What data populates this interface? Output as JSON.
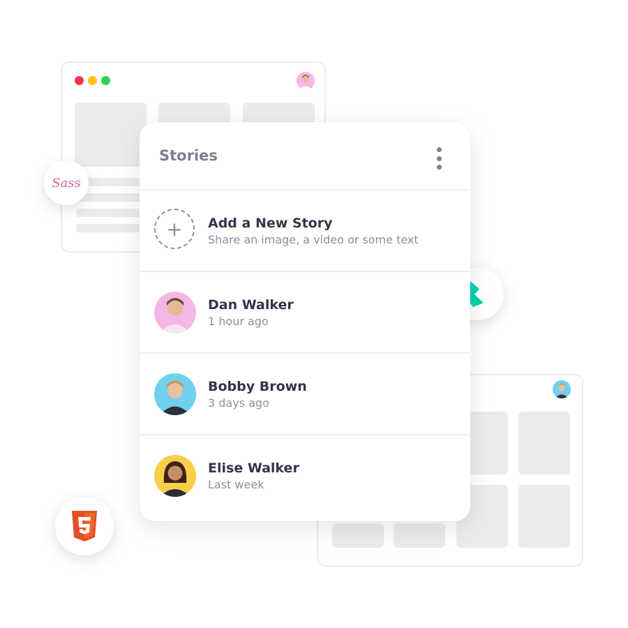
{
  "stories_card": {
    "title": "Stories",
    "add_story": {
      "label": "Add a New Story",
      "description": "Share an image, a video or some text"
    },
    "items": [
      {
        "name": "Dan Walker",
        "time": "1 hour ago",
        "avatar_bg": "#f5b8e4"
      },
      {
        "name": "Bobby Brown",
        "time": "3 days ago",
        "avatar_bg": "#6fd0f0"
      },
      {
        "name": "Elise Walker",
        "time": "Last week",
        "avatar_bg": "#f7cf4a"
      }
    ]
  },
  "badges": {
    "sass": {
      "text": "Sass",
      "color": "#cd6799"
    },
    "bulma": {
      "color": "#00d1b2"
    },
    "html5": {
      "text": "5",
      "color": "#e34f26"
    }
  },
  "window_dots": [
    "#f4334d",
    "#fcc419",
    "#30d158"
  ]
}
